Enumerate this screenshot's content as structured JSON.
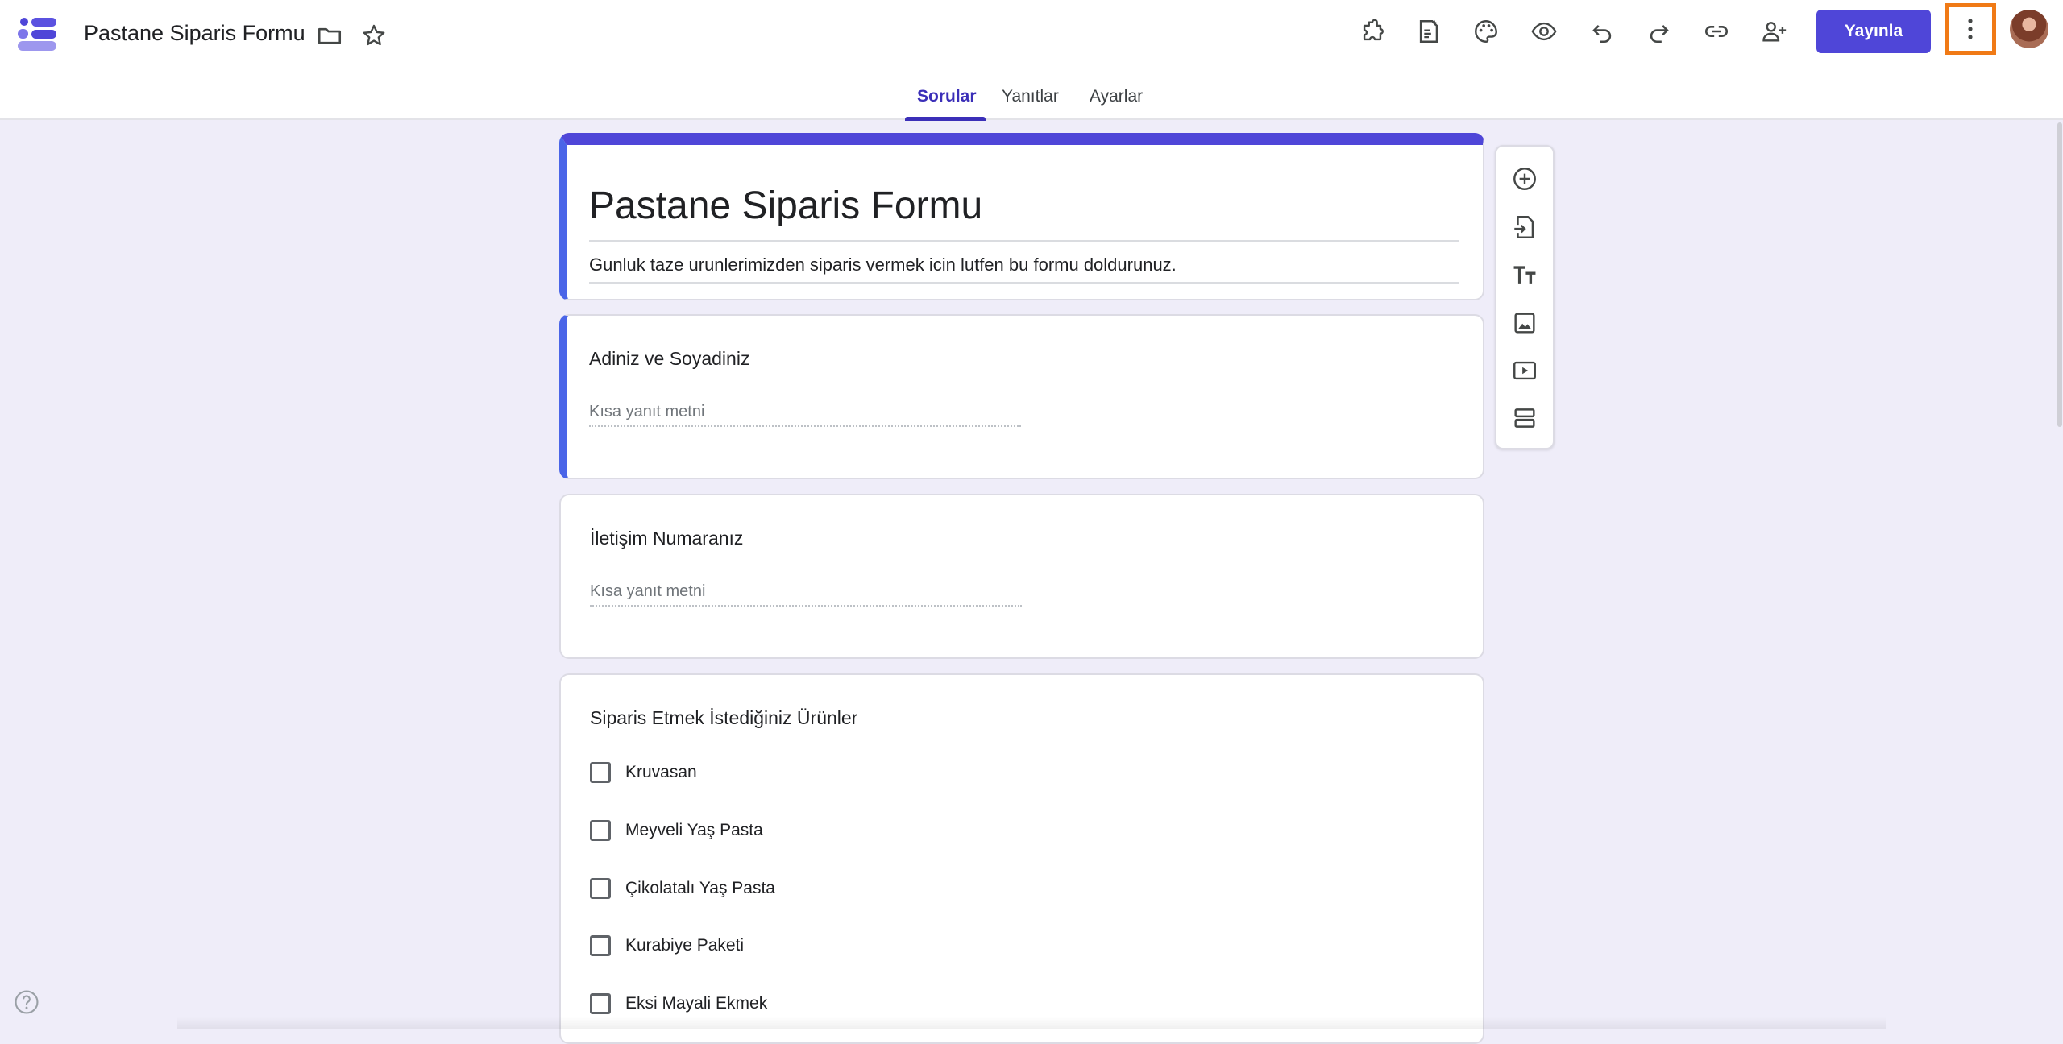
{
  "header": {
    "doc_title": "Pastane Siparis Formu",
    "publish_label": "Yayınla"
  },
  "tabs": [
    {
      "label": "Sorular",
      "active": true
    },
    {
      "label": "Yanıtlar",
      "active": false
    },
    {
      "label": "Ayarlar",
      "active": false
    }
  ],
  "form": {
    "title": "Pastane Siparis Formu",
    "description": "Gunluk taze urunlerimizden siparis vermek icin lutfen bu formu doldurunuz."
  },
  "questions": [
    {
      "title": "Adiniz ve Soyadiniz",
      "placeholder": "Kısa yanıt metni"
    },
    {
      "title": "İletişim Numaranız",
      "placeholder": "Kısa yanıt metni"
    },
    {
      "title": "Siparis Etmek İstediğiniz Ürünler",
      "options": [
        "Kruvasan",
        "Meyveli Yaş Pasta",
        "Çikolatalı Yaş Pasta",
        "Kurabiye Paketi",
        "Eksi Mayali Ekmek"
      ]
    }
  ],
  "icons": {
    "header": [
      "addons-icon",
      "customize-ai-icon",
      "palette-icon",
      "preview-icon",
      "undo-icon",
      "redo-icon",
      "link-icon",
      "add-collaborator-icon",
      "more-vert-icon"
    ],
    "toolbar": [
      "add-question-icon",
      "import-questions-icon",
      "add-title-icon",
      "add-image-icon",
      "add-video-icon",
      "add-section-icon"
    ]
  },
  "colors": {
    "accent": "#4f46d8",
    "active_border": "#4a65e8",
    "highlight": "#f07a16",
    "background": "#efedf9"
  }
}
